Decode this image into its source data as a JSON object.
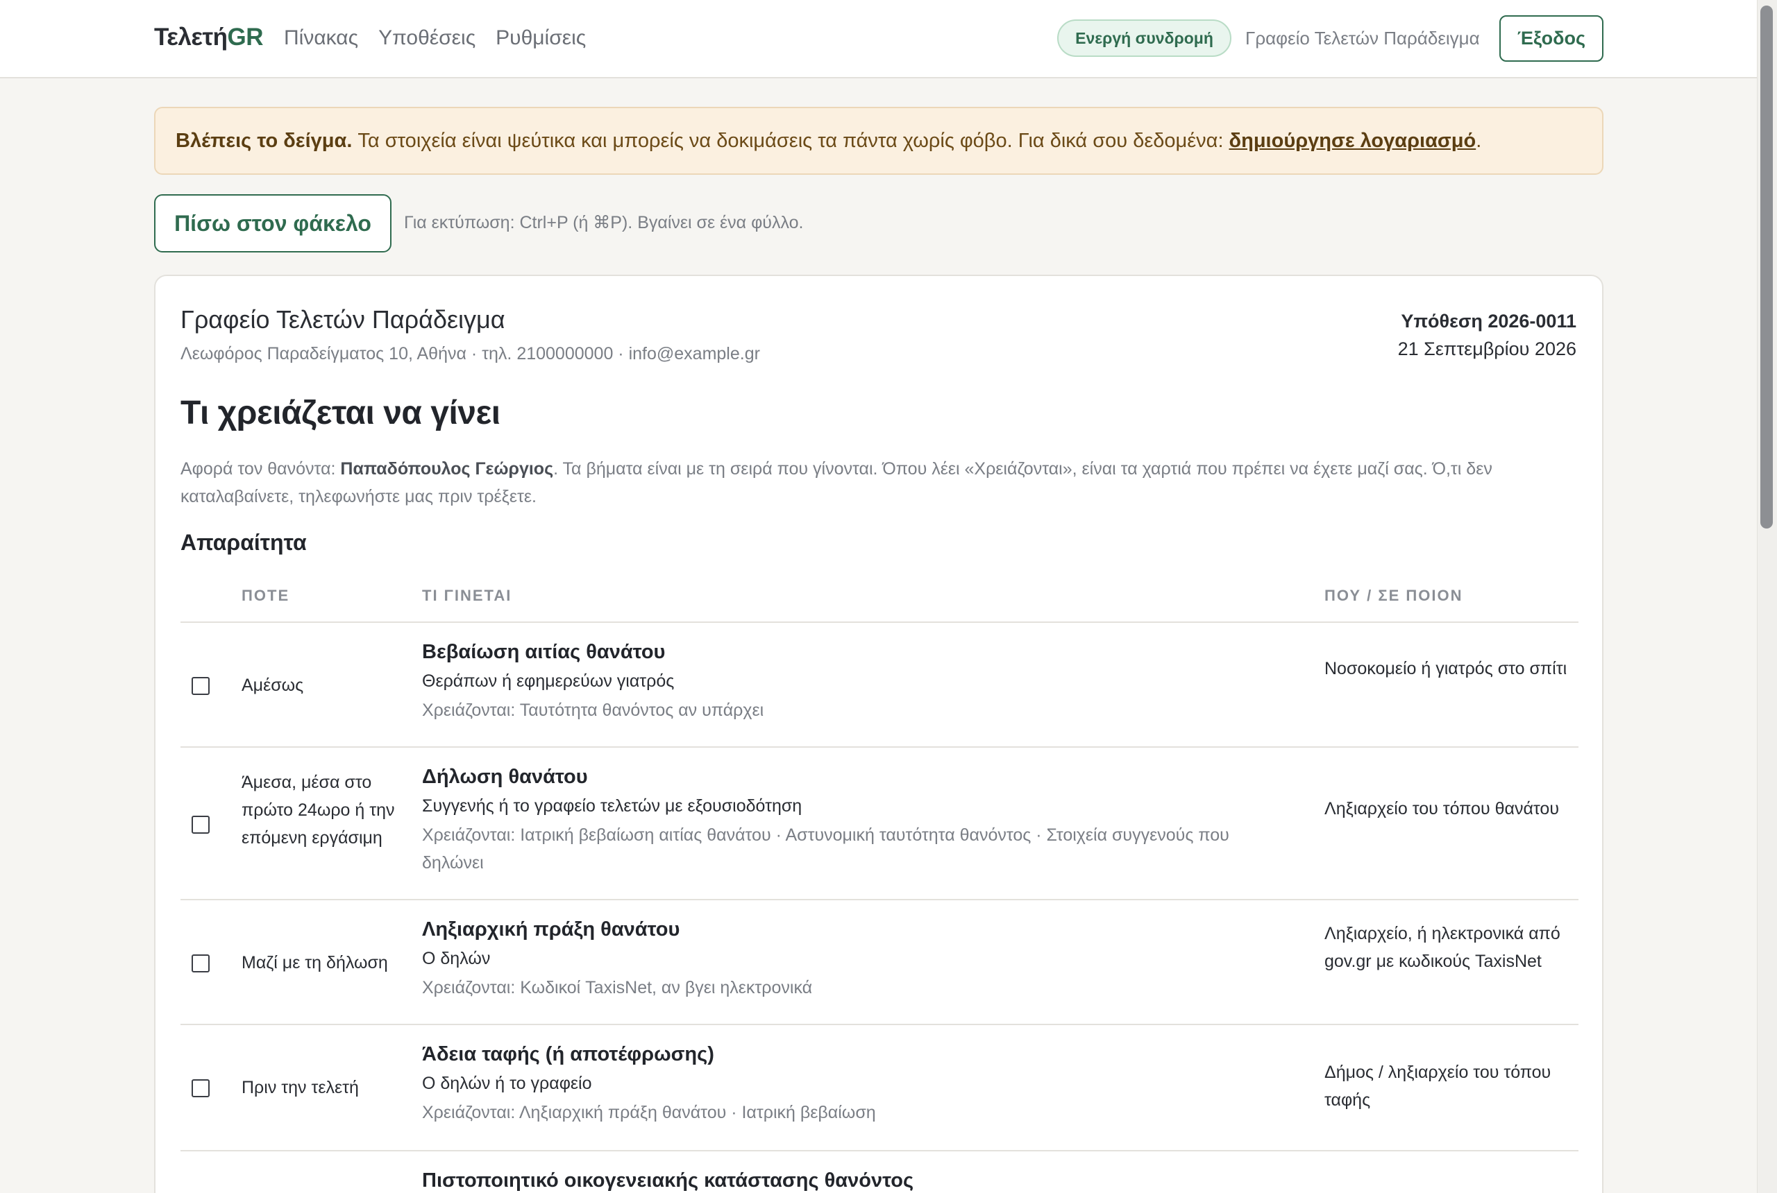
{
  "nav": {
    "brand_main": "Τελετή",
    "brand_accent": "GR",
    "links": [
      "Πίνακας",
      "Υποθέσεις",
      "Ρυθμίσεις"
    ],
    "subscription_badge": "Ενεργή συνδρομή",
    "office_name": "Γραφείο Τελετών Παράδειγμα",
    "logout_label": "Έξοδος"
  },
  "banner": {
    "strong": "Βλέπεις το δείγμα.",
    "text": "Τα στοιχεία είναι ψεύτικα και μπορείς να δοκιμάσεις τα πάντα χωρίς φόβο. Για δικά σου δεδομένα:",
    "link": "δημιούργησε λογαριασμό",
    "end": "."
  },
  "actions": {
    "back_label": "Πίσω στον φάκελο",
    "print_hint": "Για εκτύπωση: Ctrl+P (ή ⌘P). Βγαίνει σε ένα φύλλο."
  },
  "document": {
    "office": "Γραφείο Τελετών Παράδειγμα",
    "address": "Λεωφόρος Παραδείγματος 10, Αθήνα · τηλ. 2100000000 · info@example.gr",
    "case_number": "Υπόθεση 2026-0011",
    "case_date": "21 Σεπτεμβρίου 2026",
    "title": "Τι χρειάζεται να γίνει",
    "intro_before": "Αφορά τον θανόντα: ",
    "deceased": "Παπαδόπουλος Γεώργιος",
    "intro_after": ". Τα βήματα είναι με τη σειρά που γίνονται. Όπου λέει «Χρειάζονται», είναι τα χαρτιά που πρέπει να έχετε μαζί σας. Ό,τι δεν καταλαβαίνετε, τηλεφωνήστε μας πριν τρέξετε.",
    "section": "Απαραίτητα",
    "columns": {
      "when": "ΠΟΤΕ",
      "what": "ΤΙ ΓΙΝΕΤΑΙ",
      "where": "ΠΟΥ / ΣΕ ΠΟΙΟΝ"
    },
    "steps": [
      {
        "when": "Αμέσως",
        "title": "Βεβαίωση αιτίας θανάτου",
        "who": "Θεράπων ή εφημερεύων γιατρός",
        "needs": "Χρειάζονται: Ταυτότητα θανόντος αν υπάρχει",
        "where": "Νοσοκομείο ή γιατρός στο σπίτι"
      },
      {
        "when": "Άμεσα, μέσα στο πρώτο 24ωρο ή την επόμενη εργάσιμη",
        "title": "Δήλωση θανάτου",
        "who": "Συγγενής ή το γραφείο τελετών με εξουσιοδότηση",
        "needs": "Χρειάζονται: Ιατρική βεβαίωση αιτίας θανάτου · Αστυνομική ταυτότητα θανόντος · Στοιχεία συγγενούς που δηλώνει",
        "where": "Ληξιαρχείο του τόπου θανάτου"
      },
      {
        "when": "Μαζί με τη δήλωση",
        "title": "Ληξιαρχική πράξη θανάτου",
        "who": "Ο δηλών",
        "needs": "Χρειάζονται: Κωδικοί TaxisNet, αν βγει ηλεκτρονικά",
        "where": "Ληξιαρχείο, ή ηλεκτρονικά από gov.gr με κωδικούς TaxisNet"
      },
      {
        "when": "Πριν την τελετή",
        "title": "Άδεια ταφής (ή αποτέφρωσης)",
        "who": "Ο δηλών ή το γραφείο",
        "needs": "Χρειάζονται: Ληξιαρχική πράξη θανάτου · Ιατρική βεβαίωση",
        "where": "Δήμος / ληξιαρχείο του τόπου ταφής"
      },
      {
        "when": "",
        "title": "Πιστοποιητικό οικογενειακής κατάστασης θανόντος",
        "who": "",
        "needs": "",
        "where": ""
      }
    ]
  }
}
